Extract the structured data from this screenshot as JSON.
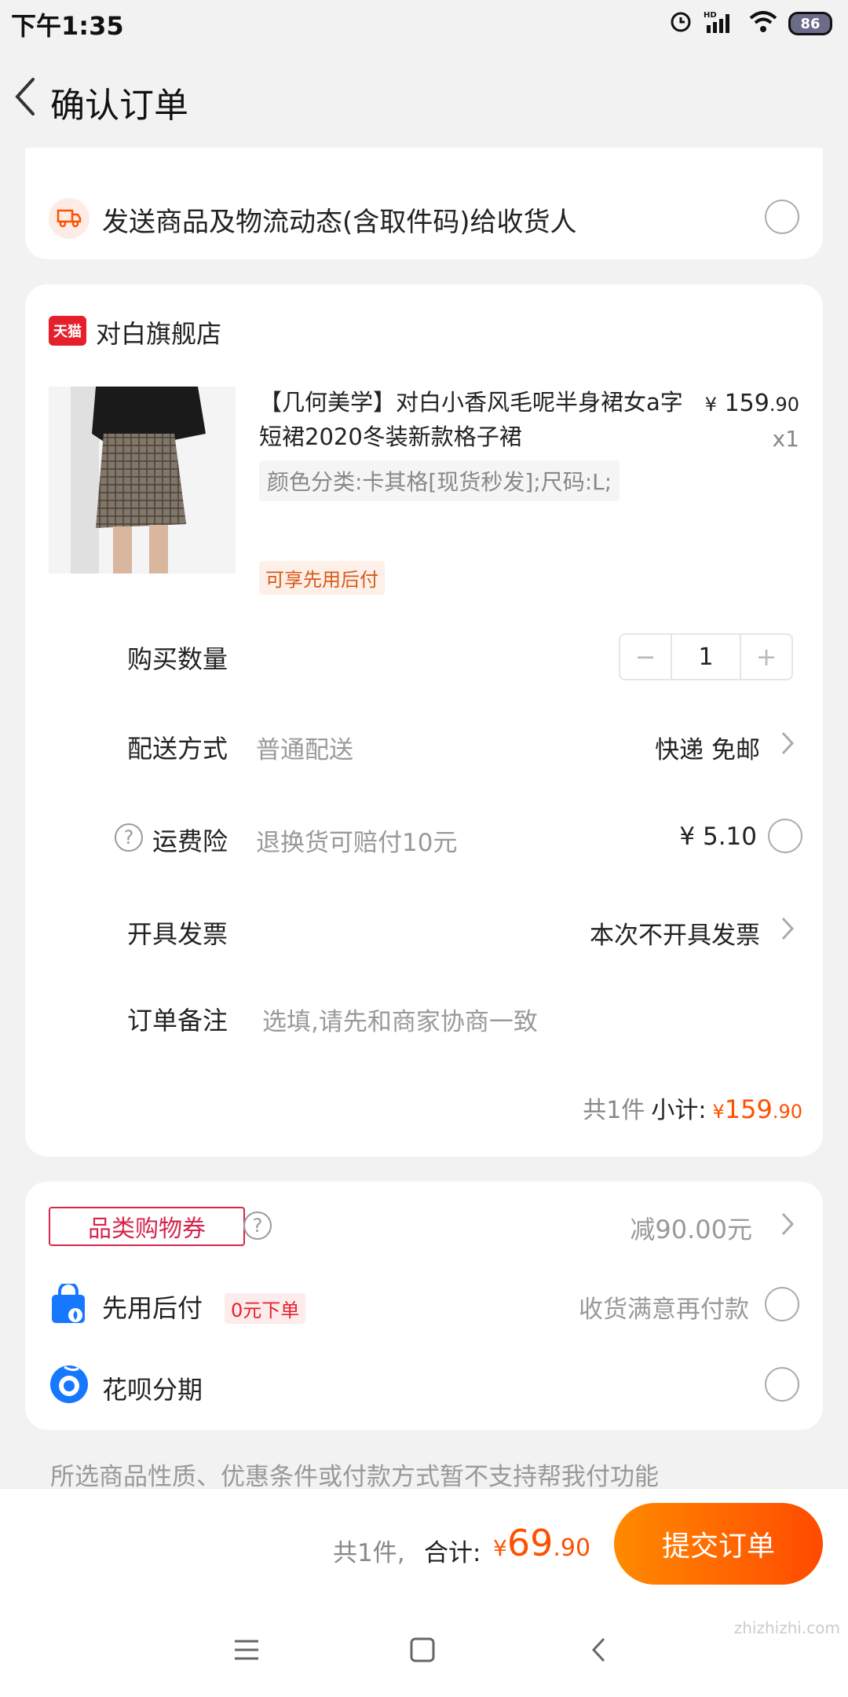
{
  "status_bar": {
    "time": "下午1:35",
    "battery": "86",
    "signal_label": "HD"
  },
  "header": {
    "title": "确认订单"
  },
  "notify": {
    "text": "发送商品及物流动态(含取件码)给收货人"
  },
  "shop": {
    "badge": "天猫",
    "name": "对白旗舰店"
  },
  "product": {
    "title": "【几何美学】对白小香风毛呢半身裙女a字短裙2020冬装新款格子裙",
    "price_symbol": "¥",
    "price_main": "159",
    "price_cents": ".90",
    "quantity_label": "x1",
    "sku": "颜色分类:卡其格[现货秒发];尺码:L;",
    "pay_later_tag": "可享先用后付"
  },
  "rows": {
    "quantity": {
      "label": "购买数量",
      "value": "1",
      "minus": "−",
      "plus": "+"
    },
    "delivery": {
      "label": "配送方式",
      "hint": "普通配送",
      "value": "快递 免邮"
    },
    "insurance": {
      "label": "运费险",
      "hint": "退换货可赔付10元",
      "value": "¥ 5.10"
    },
    "invoice": {
      "label": "开具发票",
      "value": "本次不开具发票"
    },
    "remark": {
      "label": "订单备注",
      "placeholder": "选填,请先和商家协商一致"
    }
  },
  "subtotal": {
    "count": "共1件",
    "label": "小计:",
    "symbol": "¥",
    "main": "159",
    "cents": ".90"
  },
  "payment": {
    "coupon_label": "品类购物券",
    "coupon_value": "减90.00元",
    "pay_later_label": "先用后付",
    "pay_later_tag": "0元下单",
    "pay_later_desc": "收货满意再付款",
    "huabei_label": "花呗分期"
  },
  "notice": "所选商品性质、优惠条件或付款方式暂不支持帮我付功能",
  "footer": {
    "count": "共1件,",
    "total_label": "合计:",
    "symbol": "¥",
    "main": "69",
    "cents": ".90",
    "submit": "提交订单"
  },
  "watermark": "zhizhizhi.com",
  "colors": {
    "accent": "#ff5000",
    "tmall_red": "#e5202c",
    "coupon_red": "#d6264c"
  }
}
